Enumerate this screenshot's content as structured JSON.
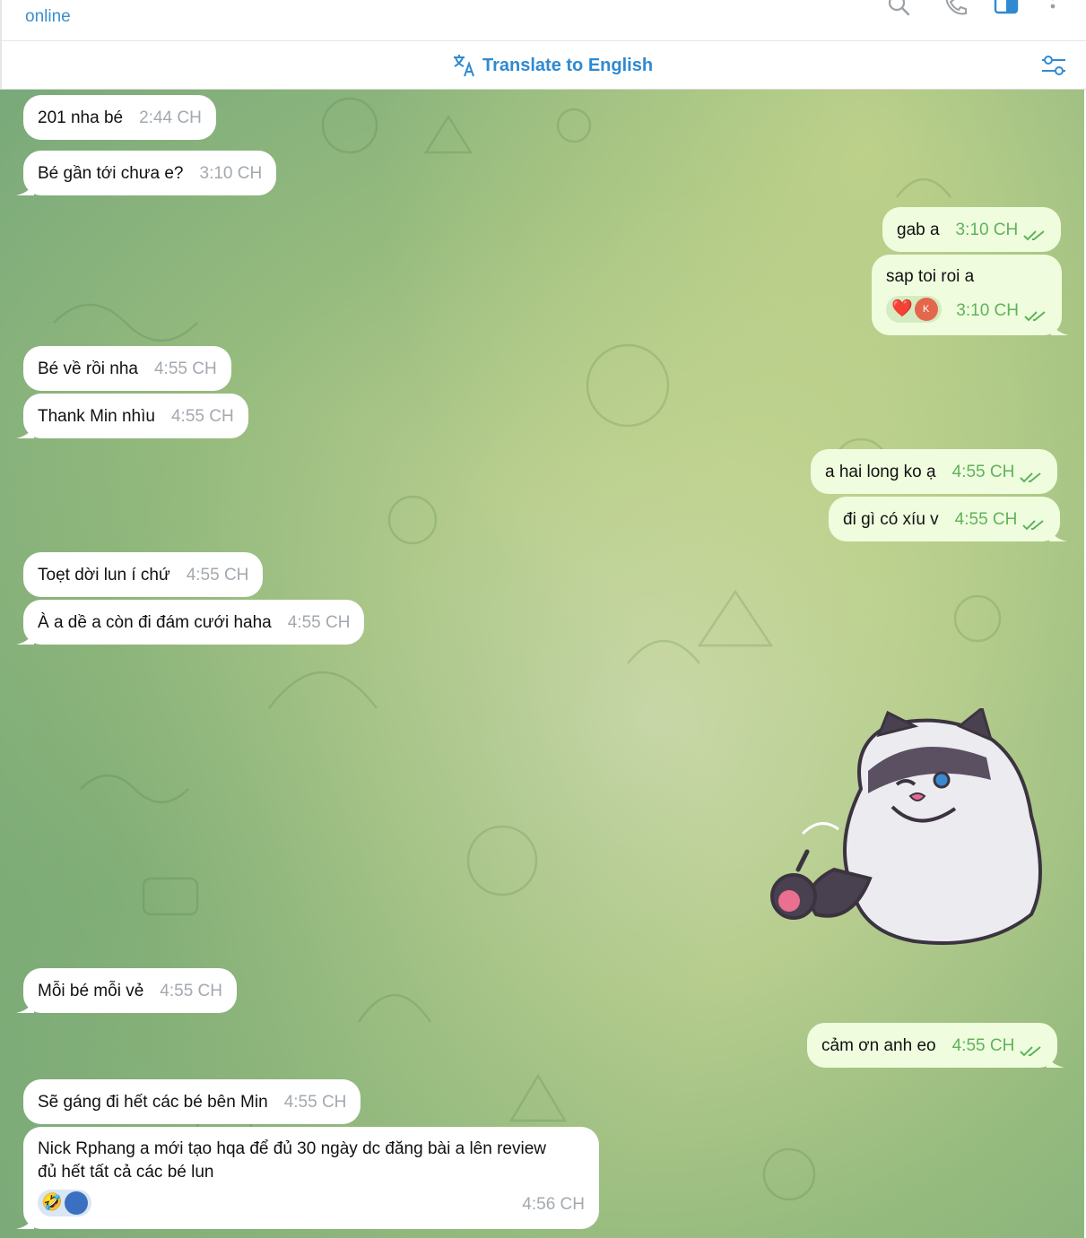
{
  "header": {
    "status": "online",
    "icons": [
      "search-icon",
      "phone-icon",
      "sidebar-toggle-icon",
      "more-vertical-icon"
    ]
  },
  "translate_bar": {
    "label": "Translate to English",
    "icons": [
      "translate-icon",
      "filter-settings-icon"
    ]
  },
  "colors": {
    "accent": "#2f8ad1",
    "outgoing_bubble": "#effdde",
    "incoming_bubble": "#ffffff",
    "outgoing_time": "#5fb35a",
    "incoming_time": "#a3a9b0"
  },
  "messages": [
    {
      "dir": "in",
      "text": "201 nha bé",
      "time": "2:44 CH"
    },
    {
      "dir": "in",
      "text": "Bé gần tới chưa e?",
      "time": "3:10 CH"
    },
    {
      "dir": "out",
      "text": "gab a",
      "time": "3:10 CH"
    },
    {
      "dir": "out",
      "text": "sap toi roi a",
      "time": "3:10 CH",
      "reaction": "❤️",
      "reaction_avatar": "K"
    },
    {
      "dir": "in",
      "text": "Bé về rồi nha",
      "time": "4:55 CH"
    },
    {
      "dir": "in",
      "text": "Thank Min nhìu",
      "time": "4:55 CH"
    },
    {
      "dir": "out",
      "text": "a hai long ko ạ",
      "time": "4:55 CH"
    },
    {
      "dir": "out",
      "text": "đi gì có xíu v",
      "time": "4:55 CH"
    },
    {
      "dir": "in",
      "text": "Toẹt dời lun í chứ",
      "time": "4:55 CH"
    },
    {
      "dir": "in",
      "text": "À a dề a còn đi đám cưới haha",
      "time": "4:55 CH"
    },
    {
      "dir": "out",
      "sticker": "cat-thumbs-up-sticker"
    },
    {
      "dir": "in",
      "text": "Mỗi bé mỗi vẻ",
      "time": "4:55 CH"
    },
    {
      "dir": "out",
      "text": "cảm ơn anh eo",
      "time": "4:55 CH"
    },
    {
      "dir": "in",
      "text": "Sẽ gáng đi hết các bé bên Min",
      "time": "4:55 CH"
    },
    {
      "dir": "in",
      "text_line1": "Nick Rphang a mới tạo hqa để đủ 30 ngày dc đăng bài a lên review",
      "text_line2": "đủ hết tất cả các bé lun",
      "time": "4:56 CH",
      "reaction": "🤣"
    }
  ]
}
